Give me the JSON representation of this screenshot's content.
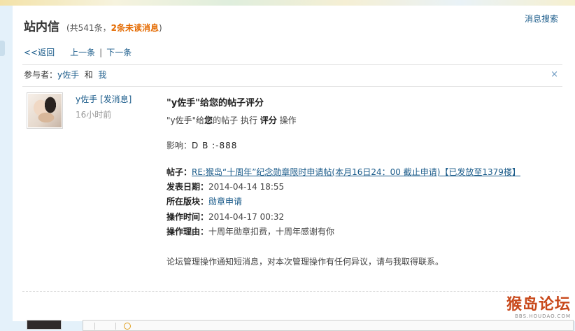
{
  "header": {
    "title": "站内信",
    "count_prefix": "(共541条，",
    "unread": "2条未读消息",
    "count_suffix": ")",
    "search_link": "消息搜索"
  },
  "nav": {
    "back": "<<返回",
    "prev": "上一条",
    "separator": "|",
    "next": "下一条"
  },
  "participants": {
    "label": "参与者：",
    "user1": "y佐手",
    "and": "和",
    "user2": "我",
    "close": "×"
  },
  "sender": {
    "name": "y佐手",
    "send_message": "[发消息]",
    "time": "16小时前"
  },
  "message": {
    "title": "\"y佐手\"给您的帖子评分",
    "summary": {
      "part1": "\"y佐手\"给",
      "you": "您",
      "part2": "的帖子 执行 ",
      "action": "评分",
      "part3": " 操作"
    },
    "impact": {
      "label": "影响：",
      "value": "D B :-888"
    },
    "post": {
      "label": "帖子：",
      "link": "RE:猴岛“十周年”纪念勋章限时申请帖(本月16日24：00 截止申请)【已发放至1379楼】"
    },
    "publish_date": {
      "label": "发表日期：",
      "value": "2014-04-14 18:55"
    },
    "board": {
      "label": "所在版块：",
      "value": "勋章申请"
    },
    "op_time": {
      "label": "操作时间：",
      "value": "2014-04-17 00:32"
    },
    "reason": {
      "label": "操作理由：",
      "value": "十周年勋章扣费，十周年感谢有你"
    },
    "footer_note": "论坛管理操作通知短消息，对本次管理操作有任何异议，请与我取得联系。"
  },
  "watermark": {
    "text": "猴岛论坛",
    "sub": "BBS.HOUDAO.COM"
  },
  "colors": {
    "link": "#1a5b8a",
    "unread": "#e46a00",
    "background": "#e4f1fa"
  },
  "icons": {
    "close": "close-icon",
    "smiley": "smiley-icon"
  }
}
